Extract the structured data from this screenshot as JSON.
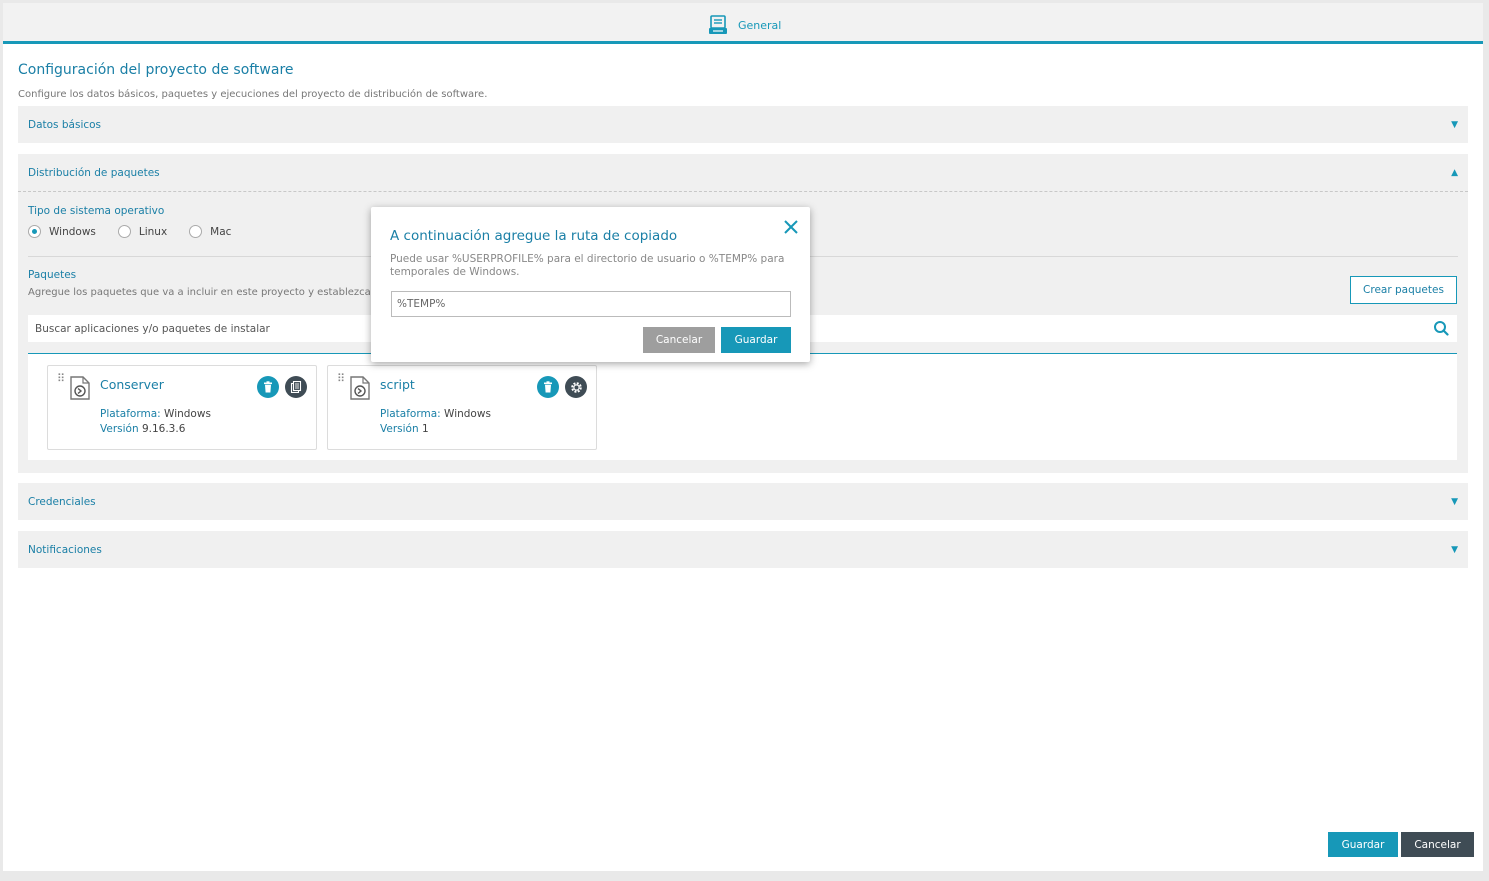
{
  "topbar": {
    "tab_label": "General",
    "tab_icon": "form-list-icon"
  },
  "page": {
    "title": "Configuración del proyecto de software",
    "description": "Configure los datos básicos, paquetes y ejecuciones del proyecto de distribución de software."
  },
  "sections": {
    "datos_basicos": "Datos básicos",
    "distribucion": "Distribución de paquetes",
    "credenciales": "Credenciales",
    "notificaciones": "Notificaciones"
  },
  "distribution": {
    "os_label": "Tipo de sistema operativo",
    "os_options": [
      "Windows",
      "Linux",
      "Mac"
    ],
    "os_selected": "Windows",
    "packages_label": "Paquetes",
    "packages_desc": "Agregue los paquetes que va a incluir en este proyecto y establezca",
    "create_button": "Crear paquetes",
    "search_placeholder": "Buscar aplicaciones y/o paquetes de instalar",
    "packages": [
      {
        "name": "Conserver",
        "platform_key": "Plataforma:",
        "platform": "Windows",
        "version_key": "Versión",
        "version": "9.16.3.6"
      },
      {
        "name": "script",
        "platform_key": "Plataforma:",
        "platform": "Windows",
        "version_key": "Versión",
        "version": "1"
      }
    ]
  },
  "modal": {
    "title": "A continuación agregue la ruta de copiado",
    "description": "Puede usar %USERPROFILE% para el directorio de usuario o %TEMP% para temporales de Windows.",
    "input_value": "%TEMP%",
    "cancel": "Cancelar",
    "save": "Guardar"
  },
  "footer": {
    "save": "Guardar",
    "cancel": "Cancelar"
  },
  "colors": {
    "accent": "#1798b8",
    "dark": "#3f4c55",
    "gray_button": "#9e9e9e"
  }
}
